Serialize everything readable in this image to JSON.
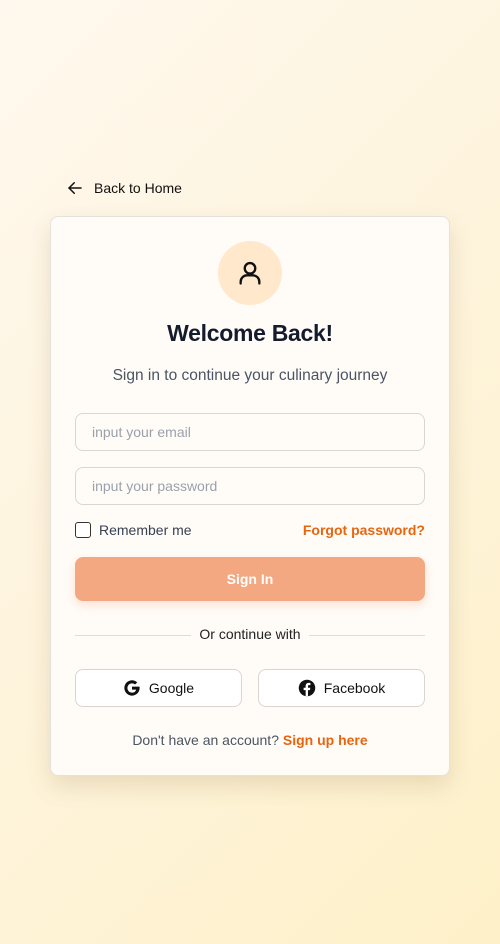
{
  "nav": {
    "back_label": "Back to Home",
    "back_icon": "arrow-left-icon"
  },
  "card": {
    "avatar_icon": "user-icon",
    "title": "Welcome Back!",
    "subtitle": "Sign in to continue your culinary journey",
    "email": {
      "value": "",
      "placeholder": "input your email"
    },
    "password": {
      "value": "",
      "placeholder": "input your password"
    },
    "remember_label": "Remember me",
    "remember_checked": false,
    "forgot_label": "Forgot password?",
    "signin_label": "Sign In",
    "divider_label": "Or continue with",
    "social": [
      {
        "label": "Google",
        "icon": "google-icon"
      },
      {
        "label": "Facebook",
        "icon": "facebook-icon"
      }
    ],
    "signup_prompt": "Don't have an account?",
    "signup_link": "Sign up here"
  },
  "colors": {
    "accent": "#e8650f",
    "button": "#f4a882",
    "avatar_bg": "#ffe8cc",
    "title": "#141b2d"
  }
}
